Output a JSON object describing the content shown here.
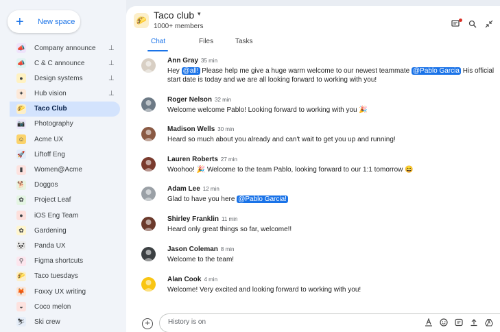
{
  "sidebar": {
    "new_space_label": "New space",
    "items": [
      {
        "label": "Company announce",
        "icon": "megaphone-icon",
        "glyph": "📣",
        "bg": "#efe3fb",
        "pinned": true
      },
      {
        "label": "C & C announce",
        "icon": "megaphone-icon",
        "glyph": "📣",
        "bg": "#e0f3f1",
        "pinned": true
      },
      {
        "label": "Design systems",
        "icon": "palette-icon",
        "glyph": "●",
        "bg": "#fff2c2",
        "pinned": true
      },
      {
        "label": "Hub vision",
        "icon": "sparkle-icon",
        "glyph": "✦",
        "bg": "#fde9d9",
        "pinned": true
      },
      {
        "label": "Taco Club",
        "icon": "taco-icon",
        "glyph": "🌮",
        "bg": "#fcefc9",
        "pinned": false,
        "active": true
      },
      {
        "label": "Photography",
        "icon": "camera-icon",
        "glyph": "📷",
        "bg": "#ede6fb",
        "pinned": false
      },
      {
        "label": "Acme UX",
        "icon": "smile-icon",
        "glyph": "☺",
        "bg": "#fbd36b",
        "pinned": false
      },
      {
        "label": "Liftoff Eng",
        "icon": "rocket-icon",
        "glyph": "🚀",
        "bg": "#e3ecf9",
        "pinned": false
      },
      {
        "label": "Women@Acme",
        "icon": "flag-icon",
        "glyph": "▮",
        "bg": "#fde2df",
        "pinned": false
      },
      {
        "label": "Doggos",
        "icon": "dog-icon",
        "glyph": "🐕",
        "bg": "#e8f3df",
        "pinned": false
      },
      {
        "label": "Project Leaf",
        "icon": "leaf-icon",
        "glyph": "✿",
        "bg": "#e4f5e3",
        "pinned": false
      },
      {
        "label": "iOS Eng Team",
        "icon": "apple-icon",
        "glyph": "●",
        "bg": "#fde0dc",
        "pinned": false
      },
      {
        "label": "Gardening",
        "icon": "flower-icon",
        "glyph": "✿",
        "bg": "#fff6cf",
        "pinned": false
      },
      {
        "label": "Panda UX",
        "icon": "panda-icon",
        "glyph": "🐼",
        "bg": "#eeeeee",
        "pinned": false
      },
      {
        "label": "Figma shortcuts",
        "icon": "magnifier-icon",
        "glyph": "⚲",
        "bg": "#fde6ee",
        "pinned": false
      },
      {
        "label": "Taco tuesdays",
        "icon": "taco-icon",
        "glyph": "🌮",
        "bg": "#fcefc9",
        "pinned": false
      },
      {
        "label": "Foxxy UX writing",
        "icon": "fox-icon",
        "glyph": "🦊",
        "bg": "#fde5d6",
        "pinned": false
      },
      {
        "label": "Coco melon",
        "icon": "melon-icon",
        "glyph": "◒",
        "bg": "#fde2df",
        "pinned": false
      },
      {
        "label": "Ski crew",
        "icon": "skier-icon",
        "glyph": "⛷",
        "bg": "#e6eef9",
        "pinned": false
      }
    ]
  },
  "header": {
    "title": "Taco club",
    "members": "1000+ members",
    "tabs": [
      "Chat",
      "Files",
      "Tasks"
    ]
  },
  "messages": [
    {
      "name": "Ann Gray",
      "time": "35 min",
      "avatar_color": "#d8cfc4",
      "line1_parts": [
        "Hey ",
        "@all!",
        " Please help me give a huge warm welcome to our newest teammate ",
        "@Pablo Garcia",
        " His official"
      ],
      "line2": "start date is today and we are all looking forward to working with you!"
    },
    {
      "name": "Roger Nelson",
      "time": "32 min",
      "avatar_color": "#6d7a86",
      "text": "Welcome welcome Pablo! Looking forward to working with you 🎉"
    },
    {
      "name": "Madison Wells",
      "time": "30 min",
      "avatar_color": "#8a5a44",
      "text": "Heard so much about you already and can't wait to get you up and running!"
    },
    {
      "name": "Lauren Roberts",
      "time": "27 min",
      "avatar_color": "#7a3b2e",
      "text": "Woohoo! 🎉 Welcome to the team Pablo, looking forward to our 1:1 tomorrow 😄"
    },
    {
      "name": "Adam Lee",
      "time": "12 min",
      "avatar_color": "#9aa0a6",
      "text_parts": [
        "Glad to have you here ",
        "@Pablo Garcia!"
      ]
    },
    {
      "name": "Shirley Franklin",
      "time": "11 min",
      "avatar_color": "#6b3a2c",
      "text": "Heard only great things so far, welcome!!"
    },
    {
      "name": "Jason Coleman",
      "time": "8 min",
      "avatar_color": "#3c4043",
      "text": "Welcome to the team!"
    },
    {
      "name": "Alan Cook",
      "time": "4 min",
      "avatar_color": "#f9c513",
      "text": "Welcome! Very excited and looking forward to working with you!"
    }
  ],
  "composer": {
    "placeholder": "History is on"
  }
}
